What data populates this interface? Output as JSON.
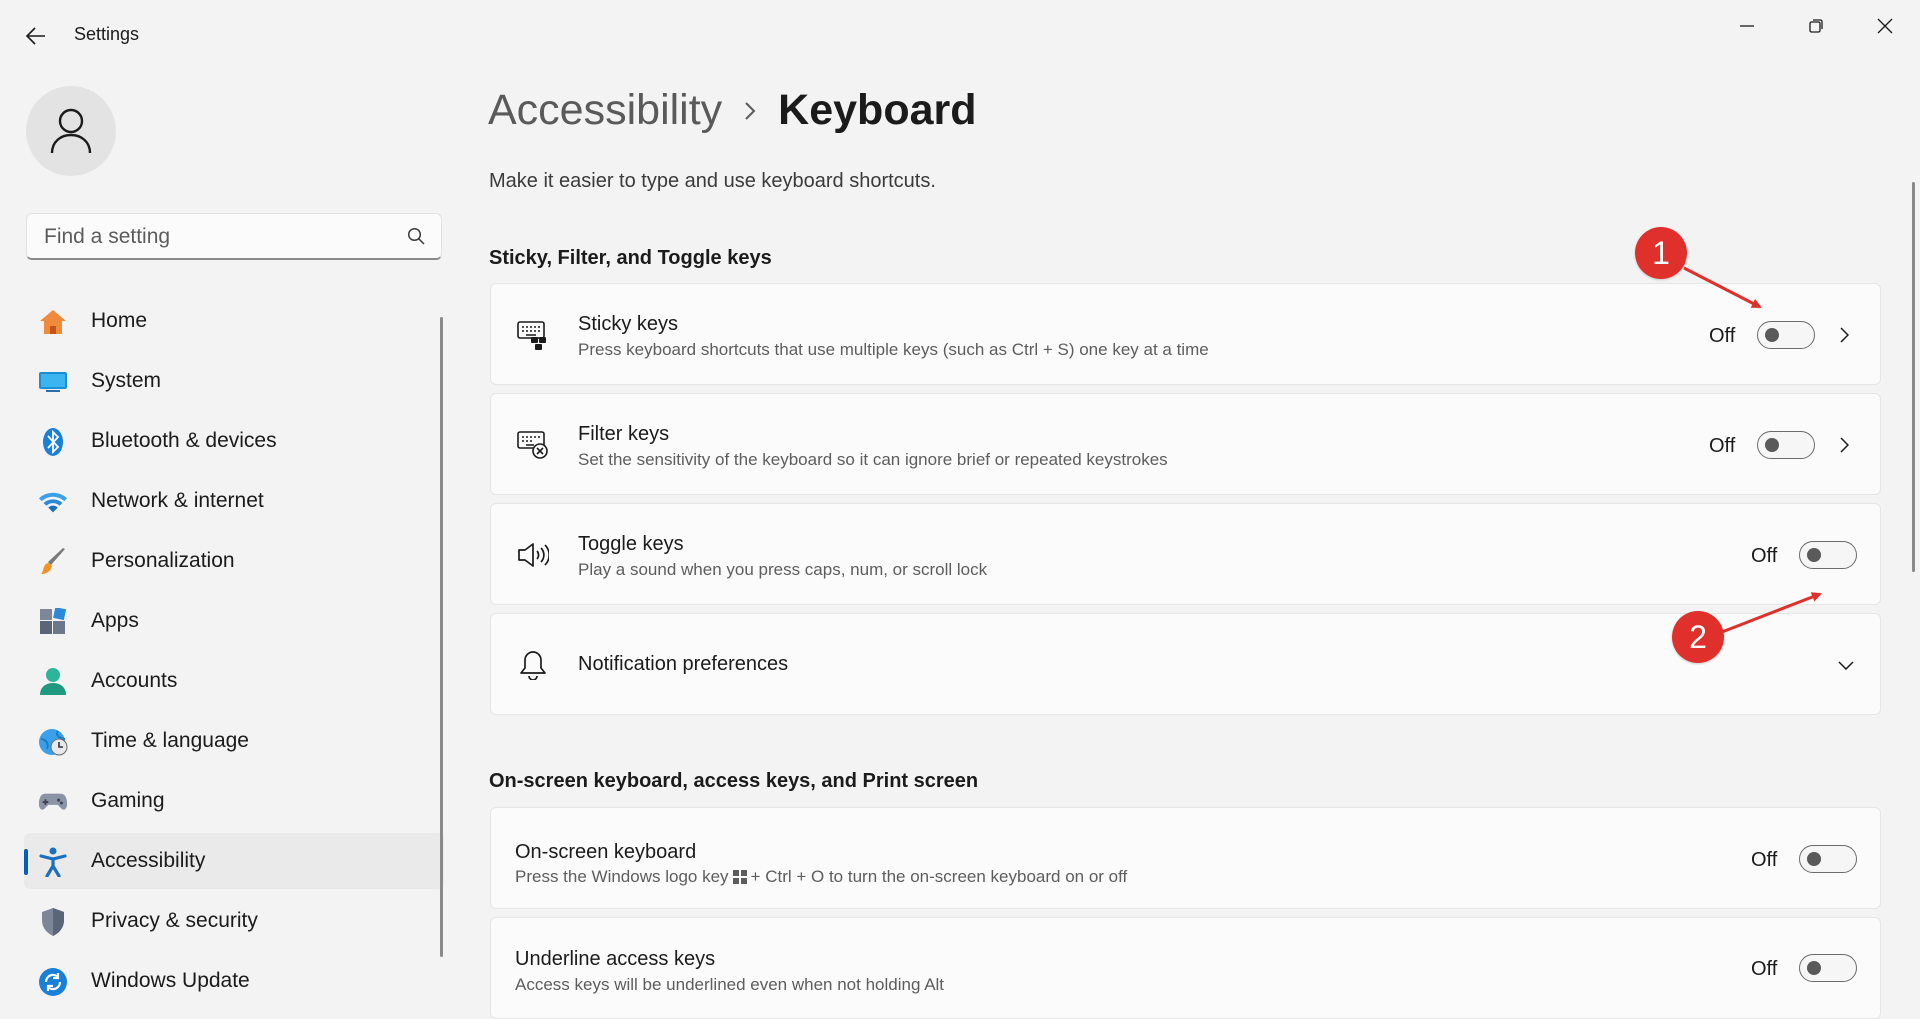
{
  "window": {
    "title": "Settings",
    "controls": [
      "minimize",
      "restore",
      "close"
    ]
  },
  "search": {
    "placeholder": "Find a setting"
  },
  "sidebar": {
    "items": [
      {
        "label": "Home",
        "icon": "home-icon"
      },
      {
        "label": "System",
        "icon": "system-icon"
      },
      {
        "label": "Bluetooth & devices",
        "icon": "bluetooth-icon"
      },
      {
        "label": "Network & internet",
        "icon": "wifi-icon"
      },
      {
        "label": "Personalization",
        "icon": "brush-icon"
      },
      {
        "label": "Apps",
        "icon": "apps-icon"
      },
      {
        "label": "Accounts",
        "icon": "accounts-icon"
      },
      {
        "label": "Time & language",
        "icon": "time-language-icon"
      },
      {
        "label": "Gaming",
        "icon": "gamepad-icon"
      },
      {
        "label": "Accessibility",
        "icon": "accessibility-icon",
        "active": true
      },
      {
        "label": "Privacy & security",
        "icon": "shield-icon"
      },
      {
        "label": "Windows Update",
        "icon": "update-icon"
      }
    ]
  },
  "breadcrumb": {
    "parent": "Accessibility",
    "current": "Keyboard"
  },
  "page": {
    "description": "Make it easier to type and use keyboard shortcuts."
  },
  "sections": [
    {
      "title": "Sticky, Filter, and Toggle keys",
      "items": [
        {
          "title": "Sticky keys",
          "subtitle": "Press keyboard shortcuts that use multiple keys (such as Ctrl + S) one key at a time",
          "state": "Off",
          "icon": "sticky-keys-icon"
        },
        {
          "title": "Filter keys",
          "subtitle": "Set the sensitivity of the keyboard so it can ignore brief or repeated keystrokes",
          "state": "Off",
          "icon": "filter-keys-icon"
        },
        {
          "title": "Toggle keys",
          "subtitle": "Play a sound when you press caps, num, or scroll lock",
          "state": "Off",
          "icon": "speaker-icon"
        },
        {
          "title": "Notification preferences",
          "icon": "bell-icon"
        }
      ]
    },
    {
      "title": "On-screen keyboard, access keys, and Print screen",
      "items": [
        {
          "title": "On-screen keyboard",
          "subtitle_pre": "Press the Windows logo key",
          "subtitle_post": "+ Ctrl + O to turn the on-screen keyboard on or off",
          "state": "Off"
        },
        {
          "title": "Underline access keys",
          "subtitle": "Access keys will be underlined even when not holding Alt",
          "state": "Off"
        }
      ]
    }
  ],
  "annotations": {
    "badge1": "1",
    "badge2": "2",
    "color": "#e0302c"
  },
  "colors": {
    "accent": "#005fb8",
    "background": "#f3f3f3",
    "card": "#fbfbfb"
  }
}
